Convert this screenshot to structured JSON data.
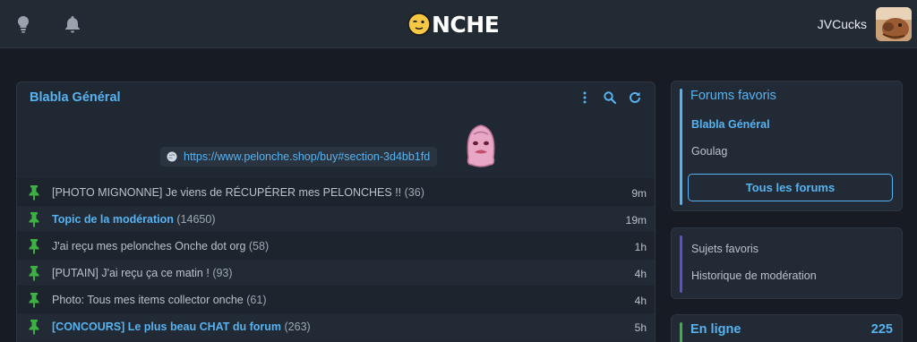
{
  "header": {
    "logo_text": "NCHE",
    "username": "JVCucks",
    "icons": [
      "lightbulb-icon",
      "bell-icon"
    ]
  },
  "forum": {
    "title": "Blabla Général",
    "actions": [
      "more-vertical-icon",
      "search-icon",
      "refresh-icon"
    ],
    "banner_link": "https://www.pelonche.shop/buy#section-3d4bb1fd",
    "topics": [
      {
        "title": "[PHOTO MIGNONNE] Je viens de RÉCUPÉRER mes PELONCHES !!",
        "count": "(36)",
        "time": "9m",
        "highlight": false
      },
      {
        "title": "Topic de la modération",
        "count": "(14650)",
        "time": "19m",
        "highlight": true
      },
      {
        "title": "J'ai reçu mes pelonches Onche dot org",
        "count": "(58)",
        "time": "1h",
        "highlight": false
      },
      {
        "title": "[PUTAIN] J'ai reçu ça ce matin !",
        "count": "(93)",
        "time": "4h",
        "highlight": false
      },
      {
        "title": "Photo: Tous mes items collector onche",
        "count": "(61)",
        "time": "4h",
        "highlight": false
      },
      {
        "title": "[CONCOURS] Le plus beau CHAT du forum",
        "count": "(263)",
        "time": "5h",
        "highlight": true
      }
    ]
  },
  "sidebar": {
    "favorites_title": "Forums favoris",
    "favorites": [
      {
        "label": "Blabla Général",
        "active": true
      },
      {
        "label": "Goulag",
        "active": false
      }
    ],
    "all_forums_label": "Tous les forums",
    "links": [
      "Sujets favoris",
      "Historique de modération"
    ],
    "online_title": "En ligne",
    "online_count": "225"
  },
  "colors": {
    "accent": "#56b3f0",
    "pin_green": "#3cb043",
    "bar_blue": "#56b3f0",
    "bar_purple": "#5a50c8",
    "bar_green": "#3cb043"
  }
}
